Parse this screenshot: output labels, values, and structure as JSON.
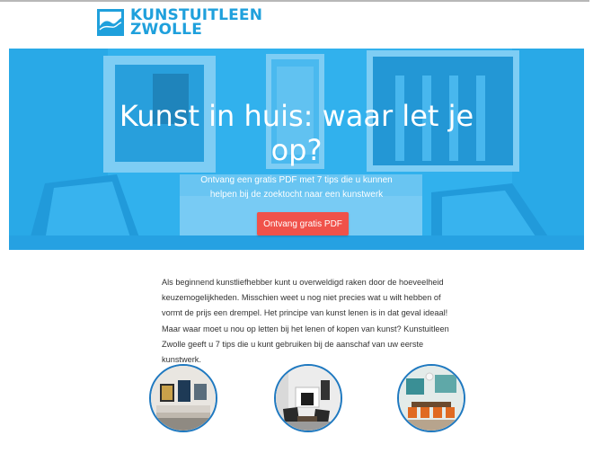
{
  "brand": {
    "name_line1": "KUNSTUITLEEN",
    "name_line2": "ZWOLLE",
    "color": "#1fa0dc"
  },
  "hero": {
    "title": "Kunst in huis: waar let je op?",
    "subtitle": "Ontvang een gratis PDF met 7 tips die u kunnen helpen bij de zoektocht naar een kunstwerk",
    "cta_label": "Ontvang gratis PDF",
    "cta_color": "#f0524a",
    "overlay_color": "#2ab0ea"
  },
  "intro": {
    "text": "Als beginnend kunstliefhebber kunt u overweldigd raken door de hoeveelheid keuzemogelijkheden. Misschien weet u nog niet precies wat u wilt hebben of vormt de prijs een drempel. Het principe van kunst lenen is in dat geval ideaal! Maar waar moet u nou op letten bij het lenen of kopen van kunst? Kunstuitleen Zwolle geeft u 7 tips die u kunt gebruiken bij de aanschaf van uw eerste kunstwerk."
  },
  "thumbnails": [
    {
      "icon": "living-room-photo"
    },
    {
      "icon": "fireplace-room-photo"
    },
    {
      "icon": "dining-room-photo"
    }
  ]
}
